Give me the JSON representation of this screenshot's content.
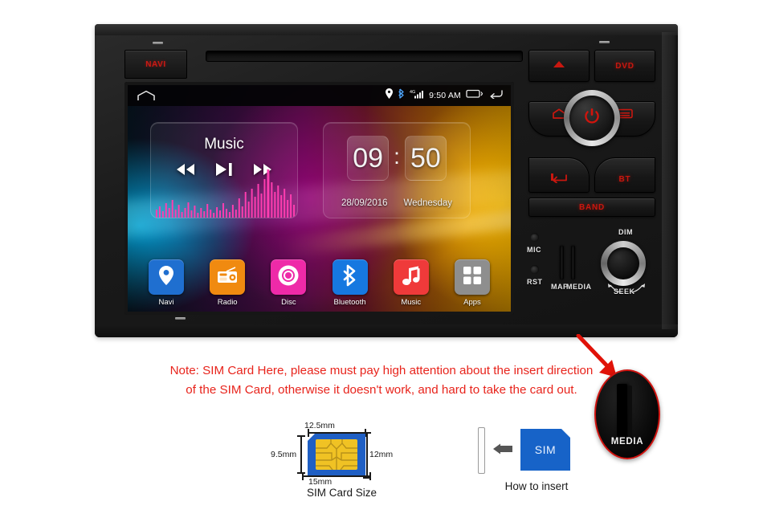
{
  "device": {
    "navi_button_label": "NAVI",
    "front_buttons": {
      "eject_label": "",
      "eject_icon": "eject-triangle-icon",
      "dvd_label": "DVD",
      "home_icon": "home-icon",
      "list_icon": "list-menu-icon",
      "back_icon": "back-arrow-icon",
      "bt_label": "BT",
      "band_label": "BAND",
      "power_icon": "power-icon"
    },
    "lower_strip": {
      "mic_label": "MIC",
      "rst_label": "RST",
      "map_label": "MAP",
      "media_label": "MEDIA",
      "dim_label": "DIM",
      "seek_label": "SEEK"
    }
  },
  "screen": {
    "statusbar": {
      "home_icon": "home-outline-icon",
      "icons": [
        "location-pin-icon",
        "bluetooth-icon",
        "signal-4g-icon"
      ],
      "clock": "9:50 AM",
      "recents_icon": "recents-icon",
      "back_icon": "back-arrow-icon"
    },
    "music_widget": {
      "title": "Music",
      "prev_icon": "rewind-icon",
      "play_pause_icon": "play-pause-icon",
      "next_icon": "fast-forward-icon"
    },
    "clock_widget": {
      "hours": "09",
      "colon": ":",
      "minutes": "50",
      "date": "28/09/2016",
      "weekday": "Wednesday"
    },
    "dock": [
      {
        "label": "Navi",
        "icon": "location-pin-icon",
        "color": "#1f6fd0"
      },
      {
        "label": "Radio",
        "icon": "radio-icon",
        "color": "#f08a10"
      },
      {
        "label": "Disc",
        "icon": "disc-icon",
        "color": "#ee2aa8"
      },
      {
        "label": "Bluetooth",
        "icon": "bluetooth-icon",
        "color": "#1678e0"
      },
      {
        "label": "Music",
        "icon": "music-note-icon",
        "color": "#ef3a3a"
      },
      {
        "label": "Apps",
        "icon": "grid-apps-icon",
        "color": "#8e8e8e"
      }
    ]
  },
  "note": {
    "line1": "Note: SIM Card Here, please must pay high attention about the insert direction",
    "line2": "of the SIM Card, otherwise it doesn't work, and hard to take the card out.",
    "color": "#e8241c"
  },
  "sim_diagram": {
    "caption": "SIM Card Size",
    "dim_top": "12.5mm",
    "dim_bottom": "15mm",
    "dim_left": "9.5mm",
    "dim_right": "12mm",
    "card_color": "#1f5fc4",
    "chip_color": "#f0c224"
  },
  "insert_diagram": {
    "caption": "How to insert",
    "card_label": "SIM",
    "arrow_icon": "left-arrow-icon",
    "card_color": "#1763c8"
  },
  "callout": {
    "label": "MEDIA",
    "outline_color": "#cf1410",
    "arrow_icon": "red-arrow-icon"
  }
}
